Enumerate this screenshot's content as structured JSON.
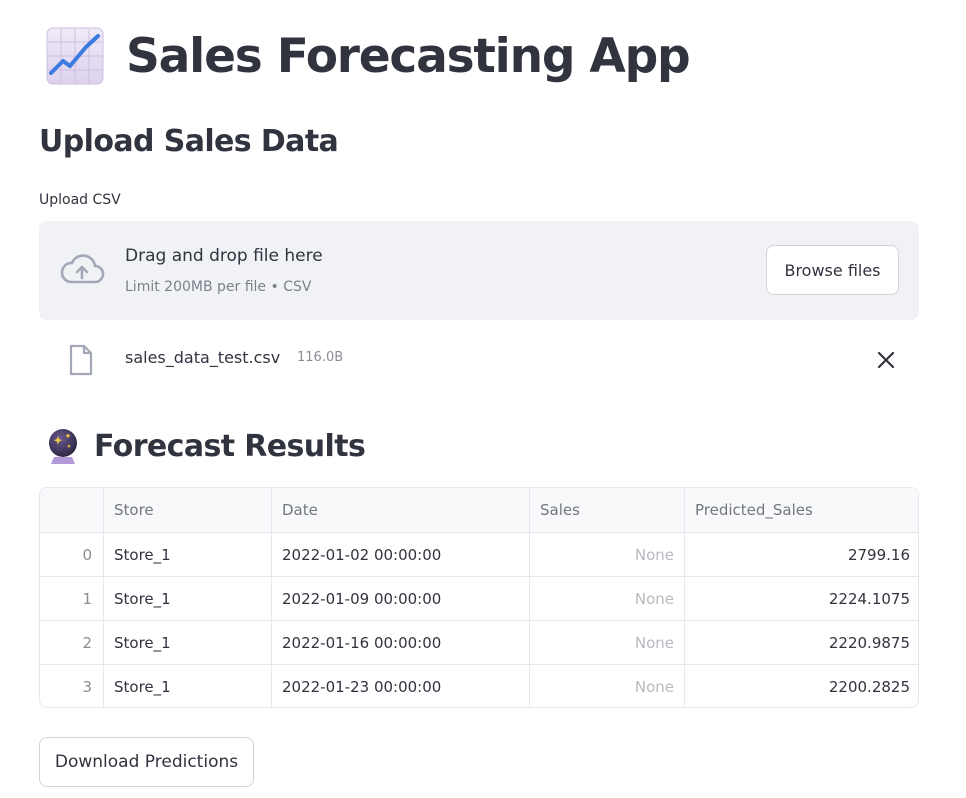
{
  "page": {
    "title": "Sales Forecasting App",
    "title_icon": "chart-increasing-icon"
  },
  "upload_section": {
    "heading": "Upload Sales Data",
    "label": "Upload CSV",
    "dropzone": {
      "icon": "cloud-upload-icon",
      "main_text": "Drag and drop file here",
      "sub_text": "Limit 200MB per file • CSV",
      "browse_label": "Browse files"
    },
    "uploaded_file": {
      "icon": "file-icon",
      "name": "sales_data_test.csv",
      "size": "116.0B",
      "remove_icon": "close-icon"
    }
  },
  "results_section": {
    "heading": "Forecast Results",
    "heading_icon": "crystal-ball-icon",
    "table": {
      "columns": [
        "",
        "Store",
        "Date",
        "Sales",
        "Predicted_Sales"
      ],
      "rows": [
        {
          "index": "0",
          "store": "Store_1",
          "date": "2022-01-02 00:00:00",
          "sales": "None",
          "predicted": "2799.16"
        },
        {
          "index": "1",
          "store": "Store_1",
          "date": "2022-01-09 00:00:00",
          "sales": "None",
          "predicted": "2224.1075"
        },
        {
          "index": "2",
          "store": "Store_1",
          "date": "2022-01-16 00:00:00",
          "sales": "None",
          "predicted": "2220.9875"
        },
        {
          "index": "3",
          "store": "Store_1",
          "date": "2022-01-23 00:00:00",
          "sales": "None",
          "predicted": "2200.2825"
        }
      ]
    }
  },
  "actions": {
    "download_label": "Download Predictions"
  },
  "colors": {
    "text": "#31333f",
    "dropzone_bg": "#f0f2f6",
    "muted": "#7d8089",
    "border": "#e6e8ee"
  }
}
